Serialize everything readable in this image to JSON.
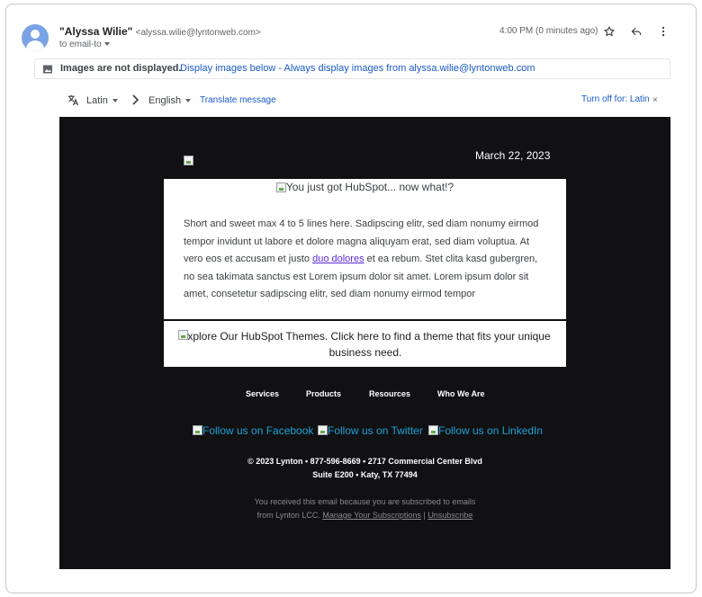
{
  "header": {
    "sender_name": "\"Alyssa Wilie\"",
    "sender_email": "<alyssa.wilie@lyntonweb.com>",
    "to_line": "to email-to",
    "time": "4:00 PM (0 minutes ago)",
    "icons": [
      "star-icon",
      "reply-icon",
      "more-vert-icon"
    ]
  },
  "image_bar": {
    "message": "Images are not displayed.",
    "link": "Display images below - Always display images from alyssa.wilie@lyntonweb.com"
  },
  "translate_bar": {
    "source_lang": "Latin",
    "target_lang": "English",
    "translate_link": "Translate message",
    "turn_off": "Turn off for: Latin",
    "close": "×"
  },
  "email": {
    "date": "March 22, 2023",
    "hero_alt": "You just got HubSpot... now what!?",
    "body_before_link": "Short and sweet max 4 to 5 lines here. Sadipscing elitr, sed diam nonumy eirmod tempor invidunt ut labore et dolore magna aliquyam erat, sed diam voluptua. At vero eos et accusam et justo ",
    "body_link": "duo dolores",
    "body_after_link": " et ea rebum. Stet clita kasd gubergren, no sea takimata sanctus est Lorem ipsum dolor sit amet. Lorem ipsum dolor sit amet, consetetur sadipscing elitr, sed diam nonumy eirmod tempor",
    "cta_alt": "Explore Our HubSpot Themes. Click here to find a theme that fits your unique business need.",
    "nav": [
      "Services",
      "Products",
      "Resources",
      "Who We Are"
    ],
    "social": [
      "Follow us on Facebook",
      "Follow us on Twitter",
      "Follow us on LinkedIn"
    ],
    "footer_line1": "© 2023 Lynton • 877-596-8669 • 2717 Commercial Center Blvd",
    "footer_line2": "Suite E200 • Katy, TX 77494",
    "unsub_line1": "You received this email because you are subscribed to emails",
    "unsub_line2_prefix": "from Lynton LCC.",
    "manage_link": "Manage Your Subscriptions",
    "separator": "|",
    "unsubscribe_link": "Unsubscribe"
  }
}
